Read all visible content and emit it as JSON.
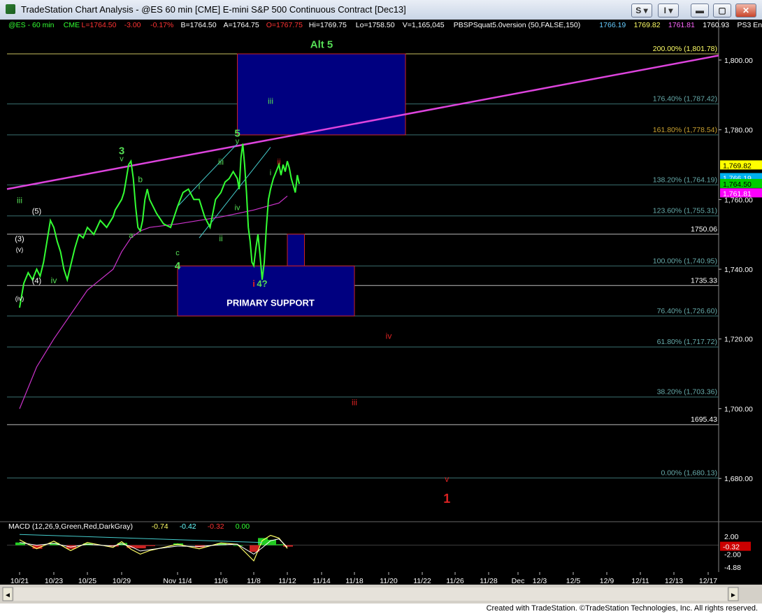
{
  "window": {
    "title": "TradeStation Chart Analysis - @ES 60 min [CME] E-mini S&P 500 Continuous Contract [Dec13]",
    "btn_s": "S",
    "btn_i": "I"
  },
  "footer": "Created with TradeStation. ©TradeStation Technologies, Inc. All rights reserved.",
  "colors": {
    "background": "#000000",
    "price": "#33ff33",
    "ma": "#cc33cc",
    "trendline": "#dd44dd",
    "channel": "#44cccc",
    "box_fill": "#000080",
    "box_border": "#cc2222",
    "fib_line": "#3a6f6f",
    "label_green": "#55dd55",
    "label_red": "#dd2222",
    "label_white": "#ffffff"
  },
  "chart_data": {
    "type": "line",
    "symbol_bar": [
      {
        "text": "@ES - 60 min",
        "color": "#33ff33"
      },
      {
        "text": "CME",
        "color": "#33ff33"
      },
      {
        "text": "L=1764.50",
        "color": "#ff3333"
      },
      {
        "text": "-3.00",
        "color": "#ff3333"
      },
      {
        "text": "-0.17%",
        "color": "#ff3333"
      },
      {
        "text": "B=1764.50",
        "color": "#ffffff"
      },
      {
        "text": "A=1764.75",
        "color": "#ffffff"
      },
      {
        "text": "O=1767.75",
        "color": "#ff3333"
      },
      {
        "text": "Hi=1769.75",
        "color": "#ffffff"
      },
      {
        "text": "Lo=1758.50",
        "color": "#ffffff"
      },
      {
        "text": "V=1,165,045",
        "color": "#ffffff"
      },
      {
        "text": "PBSPSquat5.0version (50,FALSE,150)",
        "color": "#ffffff"
      },
      {
        "text": "1766.19",
        "color": "#66ccff"
      },
      {
        "text": "1769.82",
        "color": "#ffff66"
      },
      {
        "text": "1761.81",
        "color": "#ff66ff"
      },
      {
        "text": "1760.93",
        "color": "#ffffff"
      },
      {
        "text": "PS3 Ens",
        "color": "#ffffff"
      }
    ],
    "ylim": [
      1668,
      1808
    ],
    "y_ticks": [
      1680,
      1700,
      1720,
      1740,
      1760,
      1780,
      1800
    ],
    "y_tick_labels": [
      "1,680.00",
      "1,700.00",
      "1,720.00",
      "1,740.00",
      "1,760.00",
      "1,780.00",
      "1,800.00"
    ],
    "x_dates": [
      "10/21",
      "10/23",
      "10/25",
      "10/29",
      "Nov 11/4",
      "11/6",
      "11/8",
      "11/12",
      "11/14",
      "11/18",
      "11/20",
      "11/22",
      "11/26",
      "11/28",
      "Dec",
      "12/3",
      "12/5",
      "12/9",
      "12/11",
      "12/13",
      "12/17"
    ],
    "price_series": {
      "name": "ES 60 min",
      "points": [
        [
          "10/21",
          1729
        ],
        [
          "10/21",
          1736
        ],
        [
          "10/21",
          1739
        ],
        [
          "10/21",
          1737
        ],
        [
          "10/22",
          1740
        ],
        [
          "10/22",
          1738
        ],
        [
          "10/22",
          1742
        ],
        [
          "10/22",
          1748
        ],
        [
          "10/22",
          1754
        ],
        [
          "10/23",
          1752
        ],
        [
          "10/23",
          1748
        ],
        [
          "10/23",
          1745
        ],
        [
          "10/23",
          1740
        ],
        [
          "10/23",
          1737
        ],
        [
          "10/24",
          1741
        ],
        [
          "10/24",
          1746
        ],
        [
          "10/24",
          1750
        ],
        [
          "10/24",
          1749
        ],
        [
          "10/25",
          1752
        ],
        [
          "10/25",
          1750
        ],
        [
          "10/25",
          1754
        ],
        [
          "10/25",
          1752
        ],
        [
          "10/28",
          1755
        ],
        [
          "10/28",
          1757
        ],
        [
          "10/28",
          1758
        ],
        [
          "10/28",
          1759
        ],
        [
          "10/29",
          1760
        ],
        [
          "10/29",
          1762
        ],
        [
          "10/29",
          1766
        ],
        [
          "10/29",
          1770
        ],
        [
          "10/30",
          1771
        ],
        [
          "10/30",
          1766
        ],
        [
          "10/30",
          1758
        ],
        [
          "10/30",
          1752
        ],
        [
          "10/31",
          1751
        ],
        [
          "10/31",
          1754
        ],
        [
          "10/31",
          1760
        ],
        [
          "10/31",
          1763
        ],
        [
          "11/1",
          1760
        ],
        [
          "11/1",
          1756
        ],
        [
          "11/1",
          1753
        ],
        [
          "11/1",
          1752
        ],
        [
          "11/4",
          1758
        ],
        [
          "11/4",
          1762
        ],
        [
          "11/4",
          1763
        ],
        [
          "11/4",
          1760
        ],
        [
          "11/5",
          1760
        ],
        [
          "11/5",
          1755
        ],
        [
          "11/5",
          1752
        ],
        [
          "11/5",
          1760
        ],
        [
          "11/6",
          1762
        ],
        [
          "11/6",
          1765
        ],
        [
          "11/6",
          1766
        ],
        [
          "11/6",
          1768
        ],
        [
          "11/7",
          1766
        ],
        [
          "11/7",
          1763
        ],
        [
          "11/7",
          1772
        ],
        [
          "11/7",
          1776
        ],
        [
          "11/7",
          1770
        ],
        [
          "11/7",
          1762
        ],
        [
          "11/7",
          1752
        ],
        [
          "11/7",
          1748
        ],
        [
          "11/7",
          1742
        ],
        [
          "11/8",
          1741
        ],
        [
          "11/8",
          1746
        ],
        [
          "11/8",
          1750
        ],
        [
          "11/8",
          1744
        ],
        [
          "11/8",
          1737
        ],
        [
          "11/8",
          1742
        ],
        [
          "11/8",
          1752
        ],
        [
          "11/8",
          1760
        ],
        [
          "11/10",
          1763
        ],
        [
          "11/10",
          1766
        ],
        [
          "11/10",
          1768
        ],
        [
          "11/11",
          1770
        ],
        [
          "11/11",
          1767
        ],
        [
          "11/11",
          1770
        ],
        [
          "11/11",
          1768
        ],
        [
          "11/12",
          1771
        ],
        [
          "11/12",
          1769
        ],
        [
          "11/12",
          1766
        ],
        [
          "11/12",
          1764
        ],
        [
          "11/12",
          1762
        ],
        [
          "11/12",
          1767
        ],
        [
          "11/12",
          1764.5
        ]
      ]
    },
    "ma_series": {
      "points": [
        [
          "10/21",
          1700
        ],
        [
          "10/22",
          1712
        ],
        [
          "10/23",
          1720
        ],
        [
          "10/24",
          1727
        ],
        [
          "10/25",
          1734
        ],
        [
          "10/28",
          1740
        ],
        [
          "10/29",
          1745
        ],
        [
          "10/30",
          1749
        ],
        [
          "10/31",
          1751
        ],
        [
          "11/1",
          1752
        ],
        [
          "11/4",
          1753
        ],
        [
          "11/5",
          1754
        ],
        [
          "11/6",
          1755
        ],
        [
          "11/7",
          1756
        ],
        [
          "11/8",
          1757
        ],
        [
          "11/11",
          1759
        ],
        [
          "11/12",
          1761
        ]
      ]
    },
    "fib_levels": [
      {
        "label": "200.00% (1,801.78)",
        "value": 1801.78
      },
      {
        "label": "176.40% (1,787.42)",
        "value": 1787.42
      },
      {
        "label": "161.80% (1,778.54)",
        "value": 1778.54
      },
      {
        "label": "138.20% (1,764.19)",
        "value": 1764.19
      },
      {
        "label": "123.60% (1,755.31)",
        "value": 1755.31
      },
      {
        "label": "1750.06",
        "value": 1750.06
      },
      {
        "label": "100.00% (1,740.95)",
        "value": 1740.95
      },
      {
        "label": "1735.33",
        "value": 1735.33
      },
      {
        "label": "76.40% (1,726.60)",
        "value": 1726.6
      },
      {
        "label": "61.80% (1,717.72)",
        "value": 1717.72
      },
      {
        "label": "38.20% (1,703.36)",
        "value": 1703.36
      },
      {
        "label": "1695.43",
        "value": 1695.43
      },
      {
        "label": "0.00% (1,680.13)",
        "value": 1680.13
      }
    ],
    "last_price_tags": [
      {
        "text": "1,769.82",
        "value": 1769.82,
        "bg": "#ffff00",
        "fg": "#000000"
      },
      {
        "text": "1,766.19",
        "value": 1766.19,
        "bg": "#00b0f0",
        "fg": "#ffffff"
      },
      {
        "text": "1,764.50",
        "value": 1764.5,
        "bg": "#00cc00",
        "fg": "#000000"
      },
      {
        "text": "1,761.81",
        "value": 1761.81,
        "bg": "#ff00ff",
        "fg": "#ffffff"
      }
    ],
    "boxes": [
      {
        "name": "target-box",
        "x0": "11/7",
        "x1": "11/21",
        "y0": 1778.54,
        "y1": 1801.78,
        "label": "iii",
        "label_x": "11/10",
        "label_y": 1787.4
      },
      {
        "name": "wave-ii-box",
        "x0": "11/12",
        "x1": "11/13",
        "y0": 1740.95,
        "y1": 1750.06,
        "label": "ii",
        "label_x": "11/13",
        "label_y": 1738
      },
      {
        "name": "primary-support-box",
        "x0": "11/4",
        "x1": "11/18",
        "y0": 1726.6,
        "y1": 1740.95,
        "label": "PRIMARY SUPPORT",
        "label_x": "11/10",
        "label_y": 1729.5
      }
    ],
    "wave_labels": [
      {
        "text": "Alt 5",
        "x": "11/14",
        "y": 1803.5,
        "color": "green",
        "size": 15
      },
      {
        "text": "3",
        "x": "10/29",
        "y": 1773,
        "color": "green",
        "size": 15
      },
      {
        "text": "v",
        "x": "10/29",
        "y": 1771,
        "color": "green",
        "size": 11
      },
      {
        "text": "5",
        "x": "11/7",
        "y": 1778,
        "color": "green",
        "size": 15
      },
      {
        "text": "v",
        "x": "11/7",
        "y": 1776,
        "color": "green",
        "size": 11
      },
      {
        "text": "iii",
        "x": "10/21",
        "y": 1759,
        "color": "green",
        "size": 12
      },
      {
        "text": "(5)",
        "x": "10/22",
        "y": 1756,
        "color": "white",
        "size": 11
      },
      {
        "text": "(3)",
        "x": "10/21",
        "y": 1748,
        "color": "white",
        "size": 11
      },
      {
        "text": "(v)",
        "x": "10/21",
        "y": 1745,
        "color": "white",
        "size": 9
      },
      {
        "text": "(4)",
        "x": "10/22",
        "y": 1736,
        "color": "white",
        "size": 11
      },
      {
        "text": "(iv)",
        "x": "10/21",
        "y": 1731,
        "color": "white",
        "size": 9
      },
      {
        "text": "iv",
        "x": "10/23",
        "y": 1736,
        "color": "green",
        "size": 12
      },
      {
        "text": "b",
        "x": "10/31",
        "y": 1765,
        "color": "green",
        "size": 12
      },
      {
        "text": "a",
        "x": "10/30",
        "y": 1749,
        "color": "green",
        "size": 11
      },
      {
        "text": "c",
        "x": "11/4",
        "y": 1744,
        "color": "green",
        "size": 11
      },
      {
        "text": "4",
        "x": "11/4",
        "y": 1740,
        "color": "green",
        "size": 15
      },
      {
        "text": "i",
        "x": "11/5",
        "y": 1763,
        "color": "green",
        "size": 11
      },
      {
        "text": "ii",
        "x": "11/6",
        "y": 1748,
        "color": "green",
        "size": 12
      },
      {
        "text": "iii",
        "x": "11/6",
        "y": 1770,
        "color": "green",
        "size": 12
      },
      {
        "text": "iv",
        "x": "11/7",
        "y": 1757,
        "color": "green",
        "size": 11
      },
      {
        "text": "i",
        "x": "11/10",
        "y": 1767,
        "color": "green",
        "size": 11
      },
      {
        "text": "ii",
        "x": "11/11",
        "y": 1770,
        "color": "red",
        "size": 12
      },
      {
        "text": "i",
        "x": "11/8",
        "y": 1735,
        "color": "red",
        "size": 13
      },
      {
        "text": "4?",
        "x": "11/9",
        "y": 1735,
        "color": "green",
        "size": 13
      },
      {
        "text": "iv",
        "x": "11/20",
        "y": 1720,
        "color": "red",
        "size": 12
      },
      {
        "text": "iii",
        "x": "11/18",
        "y": 1701,
        "color": "red",
        "size": 12
      },
      {
        "text": "v",
        "x": "11/25",
        "y": 1679,
        "color": "red",
        "size": 12
      },
      {
        "text": "1",
        "x": "11/25",
        "y": 1673,
        "color": "red",
        "size": 18
      }
    ],
    "macd": {
      "title": "MACD (12,26,9,Green,Red,DarkGray)",
      "values_shown": [
        {
          "text": "-0.74",
          "color": "#ffff66"
        },
        {
          "text": "-0.42",
          "color": "#66ffff"
        },
        {
          "text": "-0.32",
          "color": "#ff3333"
        },
        {
          "text": "0.00",
          "color": "#33ff33"
        }
      ],
      "ylim": [
        -6,
        4
      ],
      "ticks": [
        {
          "text": "2.00",
          "value": 2.0
        },
        {
          "text": "-2.00",
          "value": -2.0
        },
        {
          "text": "-4.88",
          "value": -4.88
        }
      ],
      "tag": {
        "text": "-0.32",
        "value": -0.32
      },
      "macd_line": [
        [
          "10/21",
          1.2
        ],
        [
          "10/22",
          -0.8
        ],
        [
          "10/23",
          0.9
        ],
        [
          "10/24",
          -1.2
        ],
        [
          "10/25",
          0.6
        ],
        [
          "10/28",
          -0.5
        ],
        [
          "10/29",
          0.8
        ],
        [
          "10/30",
          -0.9
        ],
        [
          "10/31",
          -2.0
        ],
        [
          "11/1",
          -1.2
        ],
        [
          "11/4",
          0.2
        ],
        [
          "11/5",
          -0.8
        ],
        [
          "11/6",
          0.5
        ],
        [
          "11/7",
          0.2
        ],
        [
          "11/8",
          -3.5
        ],
        [
          "11/9",
          1.0
        ],
        [
          "11/10",
          2.2
        ],
        [
          "11/11",
          1.6
        ],
        [
          "11/12",
          -0.74
        ]
      ],
      "signal_line": [
        [
          "10/21",
          0.6
        ],
        [
          "10/22",
          0.0
        ],
        [
          "10/23",
          0.4
        ],
        [
          "10/24",
          -0.4
        ],
        [
          "10/25",
          0.2
        ],
        [
          "10/28",
          -0.2
        ],
        [
          "10/29",
          0.3
        ],
        [
          "10/30",
          -0.3
        ],
        [
          "10/31",
          -1.3
        ],
        [
          "11/1",
          -1.0
        ],
        [
          "11/4",
          -0.2
        ],
        [
          "11/5",
          -0.3
        ],
        [
          "11/6",
          0.1
        ],
        [
          "11/7",
          0.2
        ],
        [
          "11/8",
          -2.0
        ],
        [
          "11/9",
          -0.6
        ],
        [
          "11/10",
          1.0
        ],
        [
          "11/11",
          1.4
        ],
        [
          "11/12",
          -0.42
        ]
      ],
      "histogram": [
        [
          "10/21",
          0.6
        ],
        [
          "10/22",
          -0.8
        ],
        [
          "10/23",
          0.5
        ],
        [
          "10/24",
          -0.8
        ],
        [
          "10/25",
          0.4
        ],
        [
          "10/28",
          -0.3
        ],
        [
          "10/29",
          0.5
        ],
        [
          "10/30",
          -0.6
        ],
        [
          "10/31",
          -0.7
        ],
        [
          "11/1",
          -0.2
        ],
        [
          "11/4",
          0.4
        ],
        [
          "11/5",
          -0.5
        ],
        [
          "11/6",
          0.4
        ],
        [
          "11/7",
          0.0
        ],
        [
          "11/8",
          -1.5
        ],
        [
          "11/9",
          1.6
        ],
        [
          "11/10",
          1.2
        ],
        [
          "11/11",
          0.2
        ],
        [
          "11/12",
          -0.32
        ]
      ]
    }
  }
}
